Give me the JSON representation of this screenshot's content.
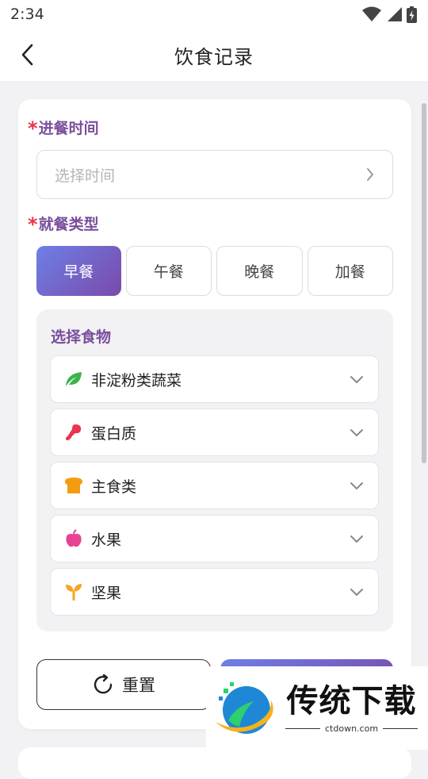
{
  "status_bar": {
    "time": "2:34"
  },
  "header": {
    "title": "饮食记录"
  },
  "form": {
    "required_mark": "*",
    "meal_time": {
      "label": "进餐时间",
      "placeholder": "选择时间"
    },
    "meal_type": {
      "label": "就餐类型",
      "options": [
        "早餐",
        "午餐",
        "晚餐",
        "加餐"
      ],
      "selected": "早餐"
    },
    "food": {
      "title": "选择食物",
      "categories": [
        {
          "name": "非淀粉类蔬菜",
          "icon": "leaf-icon",
          "color": "#3bb34a"
        },
        {
          "name": "蛋白质",
          "icon": "meat-icon",
          "color": "#e8344e"
        },
        {
          "name": "主食类",
          "icon": "bread-icon",
          "color": "#f39c12"
        },
        {
          "name": "水果",
          "icon": "apple-icon",
          "color": "#e84393"
        },
        {
          "name": "坚果",
          "icon": "sprout-icon",
          "color": "#f5a623"
        }
      ]
    },
    "reset_label": "重置"
  },
  "watermark": {
    "main": "传统下载",
    "sub": "ctdown.com"
  },
  "colors": {
    "accent_start": "#6e7fe6",
    "accent_end": "#7a4aaa",
    "label": "#7a4e9c",
    "required": "#e8344e"
  }
}
